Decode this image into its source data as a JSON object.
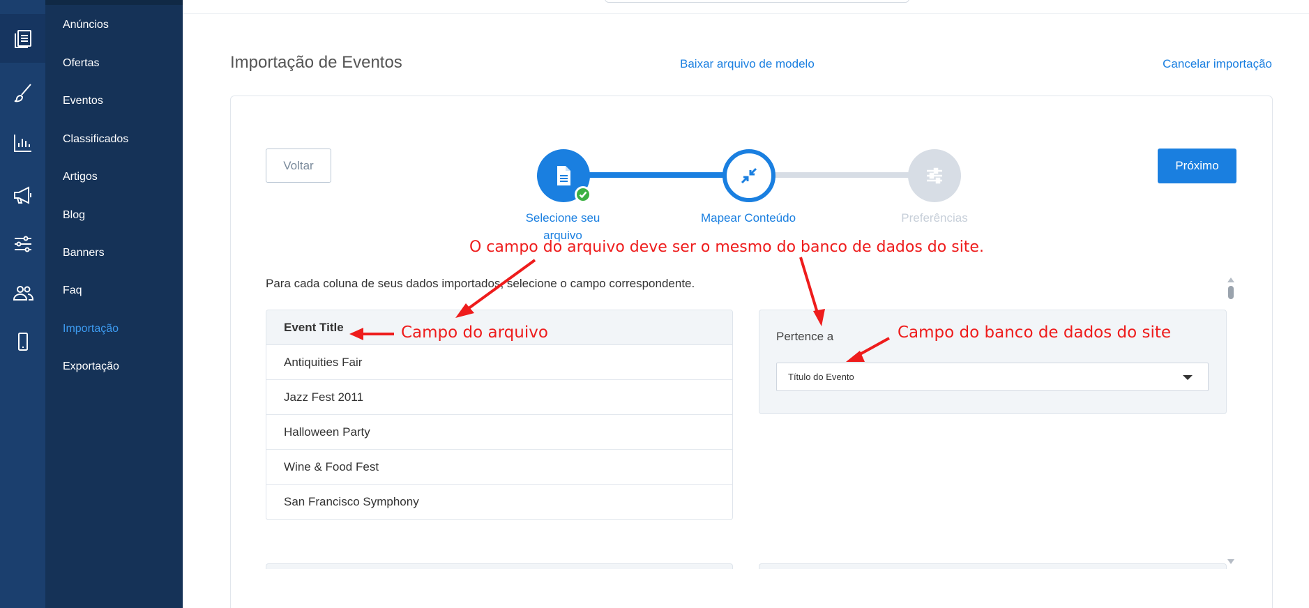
{
  "rail": {
    "icons": [
      "content-icon",
      "brush-icon",
      "chart-icon",
      "megaphone-icon",
      "settings-sliders-icon",
      "users-icon",
      "mobile-icon"
    ]
  },
  "nav": {
    "items": [
      {
        "label": "Anúncios"
      },
      {
        "label": "Ofertas"
      },
      {
        "label": "Eventos"
      },
      {
        "label": "Classificados"
      },
      {
        "label": "Artigos"
      },
      {
        "label": "Blog"
      },
      {
        "label": "Banners"
      },
      {
        "label": "Faq"
      },
      {
        "label": "Importação",
        "active": true
      },
      {
        "label": "Exportação"
      }
    ]
  },
  "page": {
    "title": "Importação de Eventos",
    "download_template": "Baixar arquivo de modelo",
    "cancel_import": "Cancelar importação"
  },
  "wizard": {
    "back_label": "Voltar",
    "next_label": "Próximo",
    "steps": [
      {
        "label": "Selecione seu arquivo",
        "state": "done"
      },
      {
        "label": "Mapear Conteúdo",
        "state": "current"
      },
      {
        "label": "Preferências",
        "state": "pending"
      }
    ]
  },
  "mapping": {
    "instruction": "Para cada coluna de seus dados importados, selecione o campo correspondente.",
    "column_header": "Event Title",
    "rows": [
      "Antiquities Fair",
      "Jazz Fest 2011",
      "Halloween Party",
      "Wine & Food Fest",
      "San Francisco Symphony"
    ],
    "belongs_label": "Pertence a",
    "selected_field": "Título do Evento"
  },
  "annotations": {
    "main": "O campo do arquivo deve ser o mesmo do banco de dados do site.",
    "file_field": "Campo do arquivo",
    "db_field": "Campo do banco de dados do site"
  },
  "colors": {
    "accent": "#1a7fe0",
    "sidebar": "#153257",
    "rail": "#1b3f6e",
    "annotation": "#ee1c1c",
    "success": "#3cb043"
  }
}
